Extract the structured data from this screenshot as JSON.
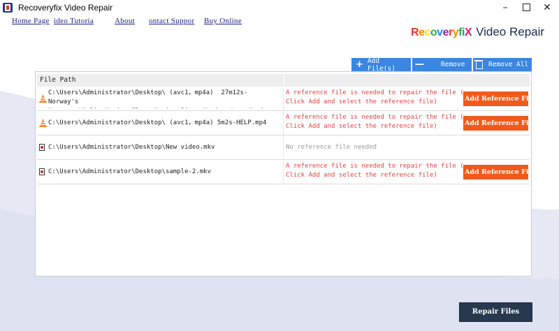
{
  "window": {
    "title": "Recoveryfix Video Repair"
  },
  "menu": [
    "Home Page",
    "ideo Tutoria",
    "About",
    "ontact Suppor",
    "Buy Online"
  ],
  "logo": {
    "brand": "RecoveryfiX",
    "product": "Video Repair"
  },
  "toolbar": {
    "add_label": "Add File(s)",
    "remove_label": "Remove",
    "remove_all_label": "Remove All"
  },
  "table": {
    "header_path": "File Path",
    "rows": [
      {
        "icon": "vlc-icon",
        "path": "C:\\Users\\Administrator\\Desktop\\ (avc1，mp4a)  27m12s- Norway's\nNature, Violin Music, Flute Music, Piano Music, Harp Music ★ . . .",
        "message": "A reference file is needed to repair the file (\nClick Add and select the reference file)",
        "button": "Add Reference File"
      },
      {
        "icon": "vlc-icon",
        "path": "C:\\Users\\Administrator\\Desktop\\ (avc1，mp4a) 5m2s-HELP.mp4",
        "message": "A reference file is needed to repair the file (\nClick Add and select the reference file)",
        "button": "Add Reference File"
      },
      {
        "icon": "mkv-file-icon",
        "path": "C:\\Users\\Administrator\\Desktop\\New video.mkv",
        "message": "No reference file needed",
        "button": ""
      },
      {
        "icon": "mkv-file-icon",
        "path": "C:\\Users\\Administrator\\Desktop\\sample-2.mkv",
        "message": "A reference file is needed to repair the file (\nClick Add and select the reference file)",
        "button": "Add Reference File"
      }
    ]
  },
  "footer": {
    "repair_label": "Repair Files"
  },
  "colors": {
    "accent_blue": "#3a86e0",
    "ref_button": "#f05a1a",
    "error_text": "#e04040",
    "repair_button": "#27384f"
  }
}
